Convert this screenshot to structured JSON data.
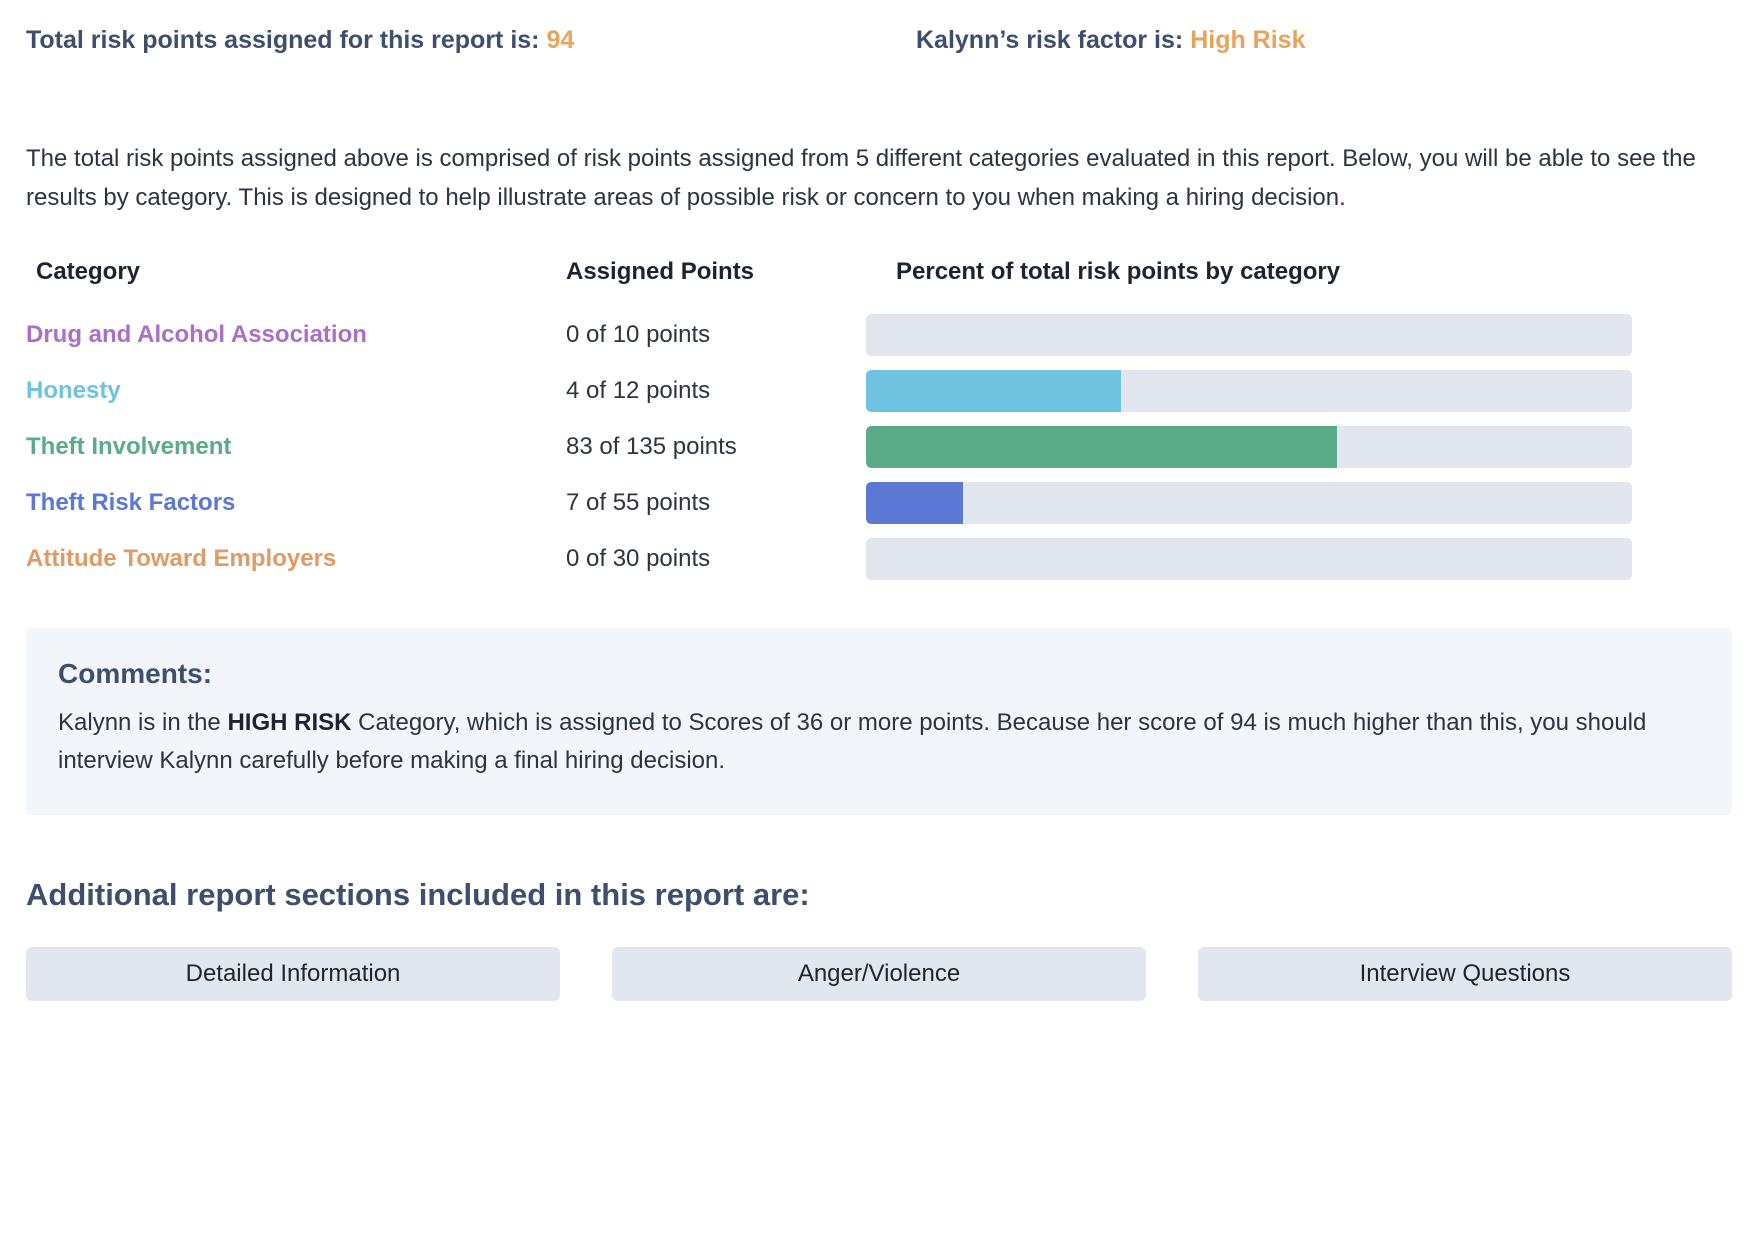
{
  "summary": {
    "total_label": "Total risk points assigned for this report is:",
    "total_value": "94",
    "risk_factor_label": "Kalynn’s risk factor is:",
    "risk_factor_value": "High Risk",
    "accent_color": "#e8a35c",
    "heading_color": "#3d4f6d"
  },
  "intro": "The total risk points assigned above is comprised of risk points assigned from 5 different categories evaluated in this report. Below, you will be able to see the results by category. This is designed to help illustrate areas of possible risk or concern to you when making a hiring decision.",
  "table": {
    "headers": {
      "category": "Category",
      "points": "Assigned Points",
      "bar": "Percent of total risk points by category"
    },
    "track_color": "#e2e6ee",
    "rows": [
      {
        "category": "Drug and Alcohol Association",
        "points_text": "0 of 10 points",
        "assigned": 0,
        "max": 10,
        "percent": 0,
        "color": "#ab6fc9"
      },
      {
        "category": "Honesty",
        "points_text": "4 of 12 points",
        "assigned": 4,
        "max": 12,
        "percent": 33.3,
        "color": "#6ec3e0"
      },
      {
        "category": "Theft Involvement",
        "points_text": "83 of 135 points",
        "assigned": 83,
        "max": 135,
        "percent": 61.5,
        "color": "#5aac88"
      },
      {
        "category": "Theft Risk Factors",
        "points_text": "7 of 55 points",
        "assigned": 7,
        "max": 55,
        "percent": 12.7,
        "color": "#5b78d4"
      },
      {
        "category": "Attitude Toward Employers",
        "points_text": "0 of 30 points",
        "assigned": 0,
        "max": 30,
        "percent": 0,
        "color": "#e09a63"
      }
    ]
  },
  "chart_data": {
    "type": "bar",
    "title": "Percent of total risk points by category",
    "categories": [
      "Drug and Alcohol Association",
      "Honesty",
      "Theft Involvement",
      "Theft Risk Factors",
      "Attitude Toward Employers"
    ],
    "values": [
      0,
      33.3,
      61.5,
      12.7,
      0
    ],
    "assigned_points": [
      0,
      4,
      83,
      7,
      0
    ],
    "max_points": [
      10,
      12,
      135,
      55,
      30
    ],
    "colors": [
      "#ab6fc9",
      "#6ec3e0",
      "#5aac88",
      "#5b78d4",
      "#e09a63"
    ],
    "xlabel": "",
    "ylabel": "",
    "xlim": [
      0,
      100
    ],
    "grid": false,
    "legend": "none",
    "orientation": "horizontal"
  },
  "comments": {
    "title": "Comments:",
    "text_before": "Kalynn is in the ",
    "emphasis": "HIGH RISK",
    "text_after": " Category, which is assigned to Scores of 36 or more points. Because her score of 94 is much higher than this, you should interview Kalynn carefully before making a final hiring decision."
  },
  "additional": {
    "title": "Additional report sections included in this report are:",
    "buttons": [
      "Detailed Information",
      "Anger/Violence",
      "Interview Questions"
    ]
  }
}
